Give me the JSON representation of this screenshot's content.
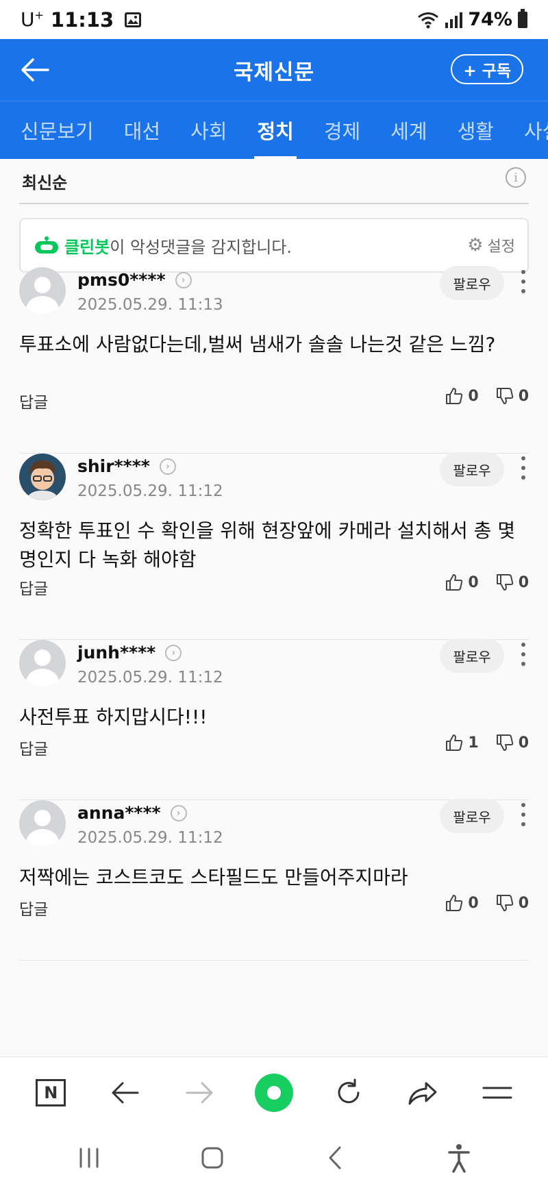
{
  "status_bar": {
    "carrier": "U",
    "carrier_sup": "+",
    "time": "11:13",
    "battery": "74%"
  },
  "header": {
    "title": "국제신문",
    "subscribe_label": "+ 구독"
  },
  "tabs": [
    {
      "label": "신문보기",
      "active": false
    },
    {
      "label": "대선",
      "active": false
    },
    {
      "label": "사회",
      "active": false
    },
    {
      "label": "정치",
      "active": true
    },
    {
      "label": "경제",
      "active": false
    },
    {
      "label": "세계",
      "active": false
    },
    {
      "label": "생활",
      "active": false
    },
    {
      "label": "사설",
      "active": false
    }
  ],
  "sort": {
    "label": "최신순"
  },
  "cleanbot": {
    "brand": "클린봇",
    "message": "이 악성댓글을 감지합니다.",
    "settings_label": "설정"
  },
  "comments": [
    {
      "nickname": "pms0****",
      "date": "2025.05.29. 11:13",
      "text": "투표소에 사람없다는데,벌써 냄새가 솔솔 나는것 같은 느낌?",
      "follow_label": "팔로우",
      "reply_label": "답글",
      "likes": "0",
      "dislikes": "0"
    },
    {
      "nickname": "shir****",
      "date": "2025.05.29. 11:12",
      "text": "정확한 투표인 수 확인을 위해 현장앞에 카메라 설치해서 총 몇명인지 다 녹화 해야함",
      "follow_label": "팔로우",
      "reply_label": "답글",
      "likes": "0",
      "dislikes": "0"
    },
    {
      "nickname": "junh****",
      "date": "2025.05.29. 11:12",
      "text": "사전투표 하지맙시다!!!",
      "follow_label": "팔로우",
      "reply_label": "답글",
      "likes": "1",
      "dislikes": "0"
    },
    {
      "nickname": "anna****",
      "date": "2025.05.29. 11:12",
      "text": "저짝에는 코스트코도 스타필드도 만들어주지마라",
      "follow_label": "팔로우",
      "reply_label": "답글",
      "likes": "0",
      "dislikes": "0"
    }
  ],
  "bottom_bar": {
    "home_logo": "N"
  },
  "colors": {
    "brand_blue": "#1a73e8",
    "cleanbot_green": "#03c75a",
    "nav_green": "#19ce60"
  }
}
